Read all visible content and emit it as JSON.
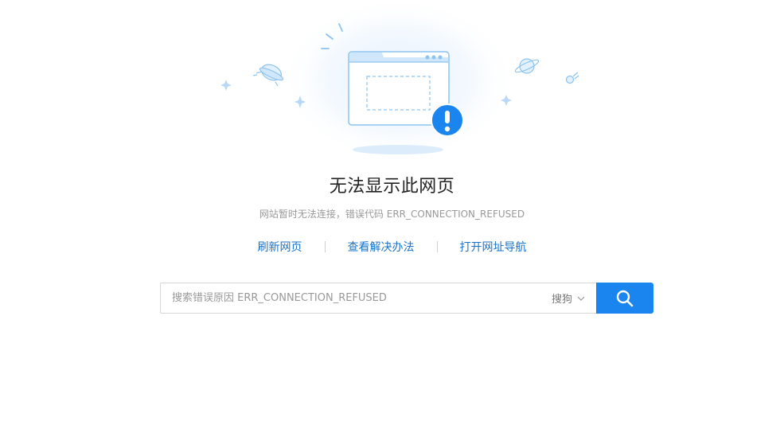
{
  "error": {
    "title": "无法显示此网页",
    "message": "网站暂时无法连接，错误代码 ERR_CONNECTION_REFUSED"
  },
  "actions": [
    {
      "label": "刷新网页"
    },
    {
      "label": "查看解决办法"
    },
    {
      "label": "打开网址导航"
    }
  ],
  "search": {
    "placeholder": "搜索错误原因 ERR_CONNECTION_REFUSED",
    "engine": "搜狗",
    "icon": "search-icon"
  },
  "colors": {
    "accent": "#1a85ee",
    "link": "#1a73c8",
    "alert": "#1a85ee",
    "illustration_light": "#dcecfb"
  }
}
